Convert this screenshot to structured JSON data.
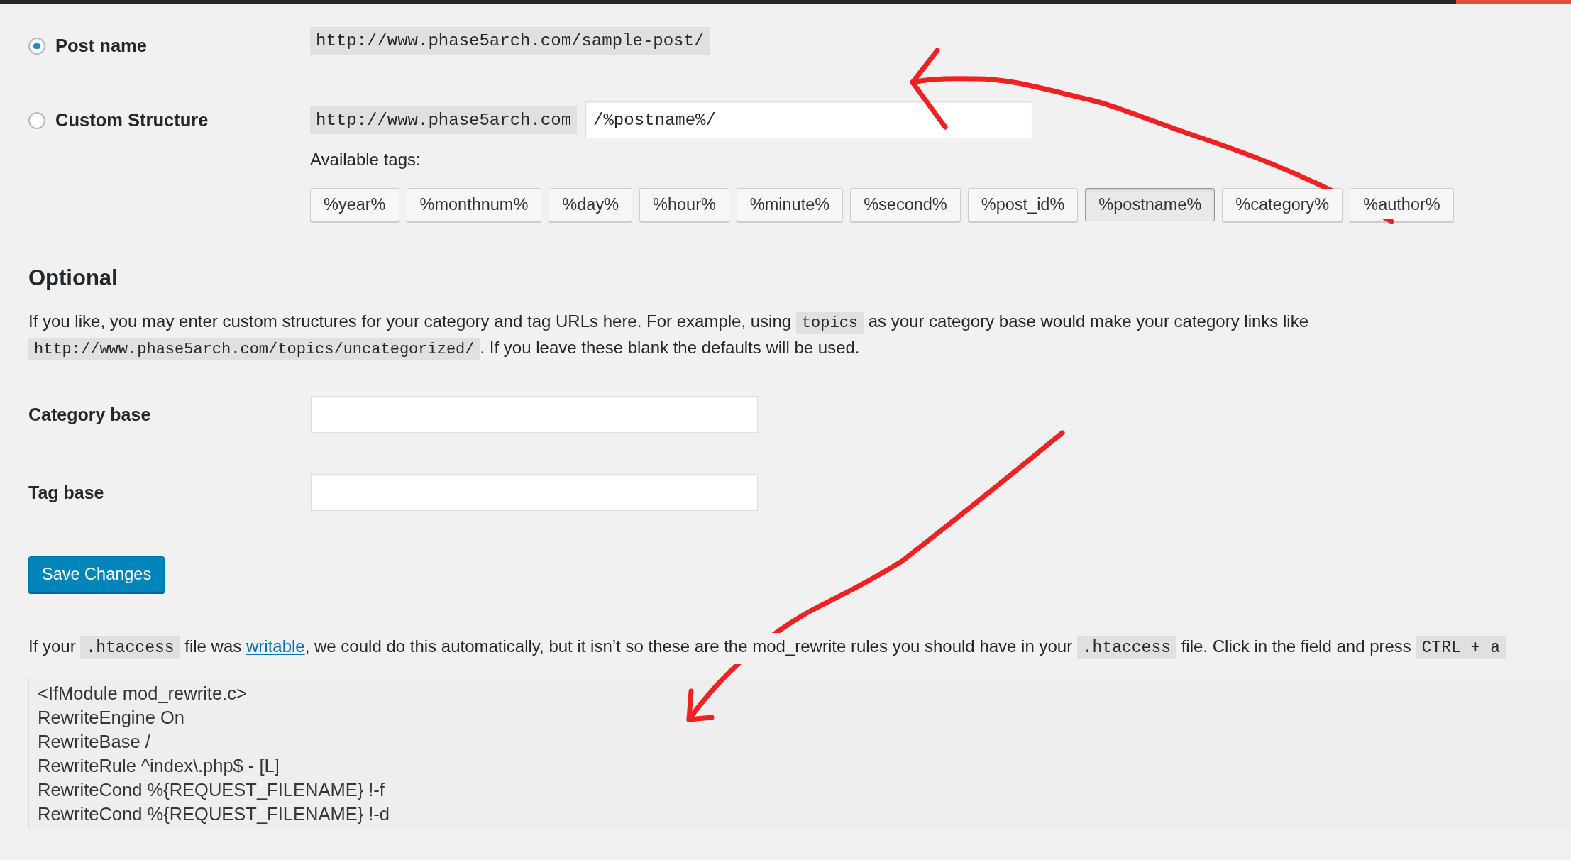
{
  "structures": [
    {
      "label": "Post name",
      "selected": true,
      "example": "http://www.phase5arch.com/sample-post/"
    },
    {
      "label": "Custom Structure",
      "selected": false,
      "prefix": "http://www.phase5arch.com",
      "value": "/%postname%/"
    }
  ],
  "available_tags_label": "Available tags:",
  "tags": [
    {
      "label": "%year%",
      "selected": false
    },
    {
      "label": "%monthnum%",
      "selected": false
    },
    {
      "label": "%day%",
      "selected": false
    },
    {
      "label": "%hour%",
      "selected": false
    },
    {
      "label": "%minute%",
      "selected": false
    },
    {
      "label": "%second%",
      "selected": false
    },
    {
      "label": "%post_id%",
      "selected": false
    },
    {
      "label": "%postname%",
      "selected": true
    },
    {
      "label": "%category%",
      "selected": false
    },
    {
      "label": "%author%",
      "selected": false
    }
  ],
  "optional": {
    "heading": "Optional",
    "description": [
      {
        "kind": "text",
        "text": "If you like, you may enter custom structures for your category and tag URLs here. For example, using "
      },
      {
        "kind": "code",
        "text": "topics"
      },
      {
        "kind": "text",
        "text": " as your category base would make your category links like "
      },
      {
        "kind": "code",
        "text": "http://www.phase5arch.com/topics/uncategorized/"
      },
      {
        "kind": "text",
        "text": ". If you leave these blank the defaults will be used."
      }
    ],
    "fields": [
      {
        "label": "Category base"
      },
      {
        "label": "Tag base"
      }
    ]
  },
  "save_button": "Save Changes",
  "htaccess_note": [
    {
      "kind": "text",
      "text": "If your "
    },
    {
      "kind": "code",
      "text": ".htaccess"
    },
    {
      "kind": "text",
      "text": " file was "
    },
    {
      "kind": "link",
      "text": "writable"
    },
    {
      "kind": "text",
      "text": ", we could do this automatically, but it isn’t so these are the mod_rewrite rules you should have in your "
    },
    {
      "kind": "code",
      "text": ".htaccess"
    },
    {
      "kind": "text",
      "text": " file. Click in the field and press "
    },
    {
      "kind": "code",
      "text": "CTRL + a"
    }
  ],
  "rewrite_rules": [
    "<IfModule mod_rewrite.c>",
    "RewriteEngine On",
    "RewriteBase /",
    "RewriteRule ^index\\.php$ - [L]",
    "RewriteCond %{REQUEST_FILENAME} !-f",
    "RewriteCond %{REQUEST_FILENAME} !-d"
  ]
}
